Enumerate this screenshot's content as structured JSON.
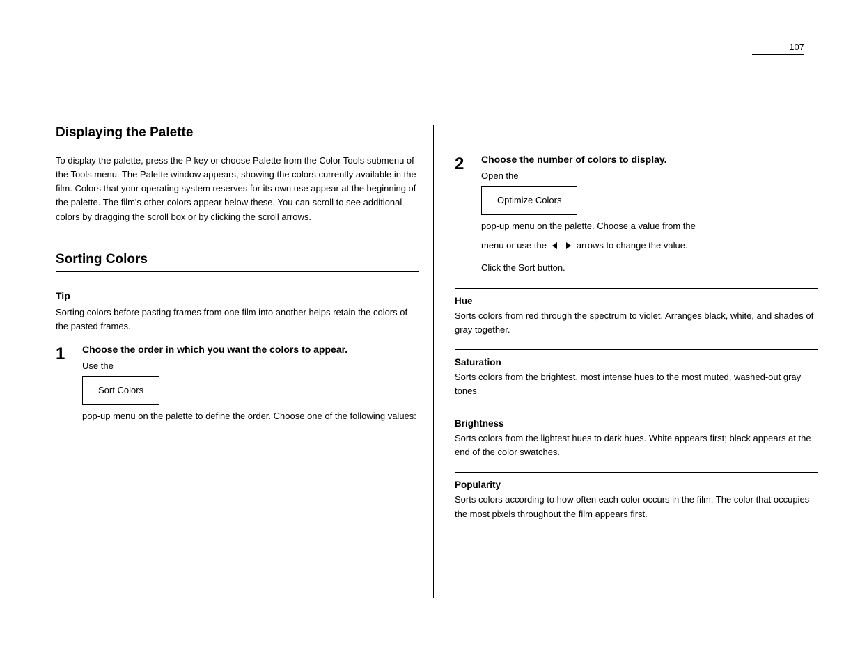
{
  "page_number": "107",
  "left": {
    "section1": {
      "title": "Displaying the Palette",
      "body": "To display the palette, press the P key or choose Palette from the Color Tools submenu of the Tools menu. The Palette window appears, showing the colors currently available in the film. Colors that your operating system reserves for its own use appear at the beginning of the palette. The film's other colors appear below these. You can scroll to see additional colors by dragging the scroll box or by clicking the scroll arrows."
    },
    "section2": {
      "title": "Sorting Colors",
      "tip_label": "Tip",
      "tip_body": "Sorting colors before pasting frames from one film into another helps retain the colors of the pasted frames.",
      "step_num": "1",
      "step_head": "Choose the order in which you want the colors to appear.",
      "step_body": "Use the",
      "button": "Sort Colors",
      "after_button": "pop-up menu on the palette to define the order. Choose one of the following values:"
    }
  },
  "right": {
    "step2": {
      "num": "2",
      "head": "Choose the number of colors to display.",
      "body_before_button": "Open the",
      "button": "Optimize Colors",
      "body_after_button": "pop-up menu on the palette. Choose a value from the"
    },
    "arrow_line": "menu or use the      arrows to change the value.",
    "arrow_after": "Click the Sort button.",
    "rules": [
      {
        "title": "Hue",
        "body": "Sorts colors from red through the spectrum to violet. Arranges black, white, and shades of gray together."
      },
      {
        "title": "Saturation",
        "body": "Sorts colors from the brightest, most intense hues to the most muted, washed-out gray tones."
      },
      {
        "title": "Brightness",
        "body": "Sorts colors from the lightest hues to dark hues. White appears first; black appears at the end of the color swatches."
      },
      {
        "title": "Popularity",
        "body": "Sorts colors according to how often each color occurs in the film. The color that occupies the most pixels throughout the film appears first."
      }
    ]
  }
}
